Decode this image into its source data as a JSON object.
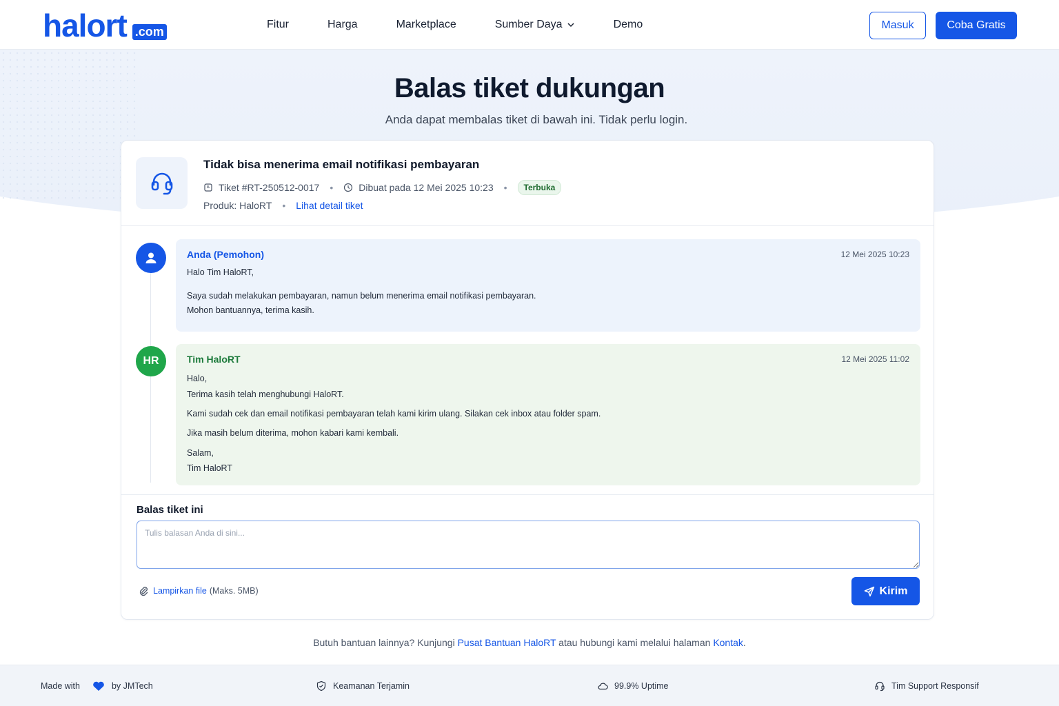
{
  "colors": {
    "primary": "#1556e6",
    "success": "#1fa64a",
    "user_bubble": "#edf3fc",
    "staff_bubble": "#eef6ed"
  },
  "brand": {
    "name": "halort",
    "suffix": ".com"
  },
  "nav": {
    "items": [
      "Fitur",
      "Harga",
      "Marketplace",
      "Sumber Daya",
      "Demo"
    ],
    "login_label": "Masuk",
    "trial_label": "Coba Gratis"
  },
  "page": {
    "title": "Balas tiket dukungan",
    "subtitle": "Anda dapat membalas tiket di bawah ini. Tidak perlu login."
  },
  "ticket": {
    "icon": "headset-icon",
    "subject": "Tidak bisa menerima email notifikasi pembayaran",
    "id_label": "Tiket #RT-250512-0017",
    "created_label": "Dibuat pada 12 Mei 2025 10:23",
    "status": "Terbuka",
    "product_label": "Produk: HaloRT",
    "detail_link": "Lihat detail tiket"
  },
  "messages": [
    {
      "author": "Anda (Pemohon)",
      "time": "12 Mei 2025 10:23",
      "lines": [
        "Halo Tim HaloRT,",
        "Saya sudah melakukan pembayaran, namun belum menerima email notifikasi pembayaran.",
        "Mohon bantuannya, terima kasih."
      ]
    },
    {
      "author": "Tim HaloRT",
      "avatar_initials": "HR",
      "time": "12 Mei 2025 11:02",
      "lines": [
        "Halo,",
        "Terima kasih telah menghubungi HaloRT.",
        "Kami sudah cek dan email notifikasi pembayaran telah kami kirim ulang. Silakan cek inbox atau folder spam.",
        "Jika masih belum diterima, mohon kabari kami kembali.",
        "Salam,",
        "Tim HaloRT"
      ]
    }
  ],
  "reply": {
    "label": "Balas tiket ini",
    "placeholder": "Tulis balasan Anda di sini...",
    "value": "",
    "attach_link": "Lampirkan file",
    "attach_note": "(Maks. 5MB)",
    "send_label": "Kirim"
  },
  "help": {
    "prefix": "Butuh bantuan lainnya? Kunjungi",
    "link1": "Pusat Bantuan HaloRT",
    "middle": "atau hubungi kami melalui halaman",
    "link2": "Kontak",
    "suffix": "."
  },
  "footer": {
    "made_with": "Made with",
    "by": "by JMTech",
    "security": "Keamanan Terjamin",
    "uptime": "99.9% Uptime",
    "support": "Tim Support Responsif"
  }
}
